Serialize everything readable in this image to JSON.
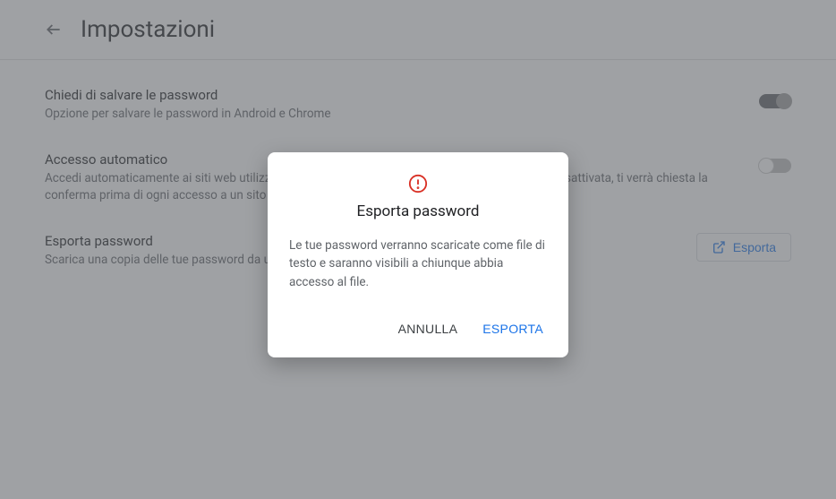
{
  "header": {
    "title": "Impostazioni"
  },
  "settings": [
    {
      "title": "Chiedi di salvare le password",
      "desc": "Opzione per salvare le password in Android e Chrome",
      "toggle": "on"
    },
    {
      "title": "Accesso automatico",
      "desc": "Accedi automaticamente ai siti web utilizzando le credenziali memorizzate. Se la funzionalità è disattivata, ti verrà chiesta la conferma prima di ogni accesso a un sito web.",
      "toggle": "off"
    },
    {
      "title": "Esporta password",
      "desc": "Scarica una copia delle tue password da utilizzare con un altro servizio"
    }
  ],
  "export_button": "Esporta",
  "dialog": {
    "title": "Esporta password",
    "body": "Le tue password verranno scaricate come file di testo e saranno visibili a chiunque abbia accesso al file.",
    "cancel": "ANNULLA",
    "confirm": "ESPORTA"
  }
}
